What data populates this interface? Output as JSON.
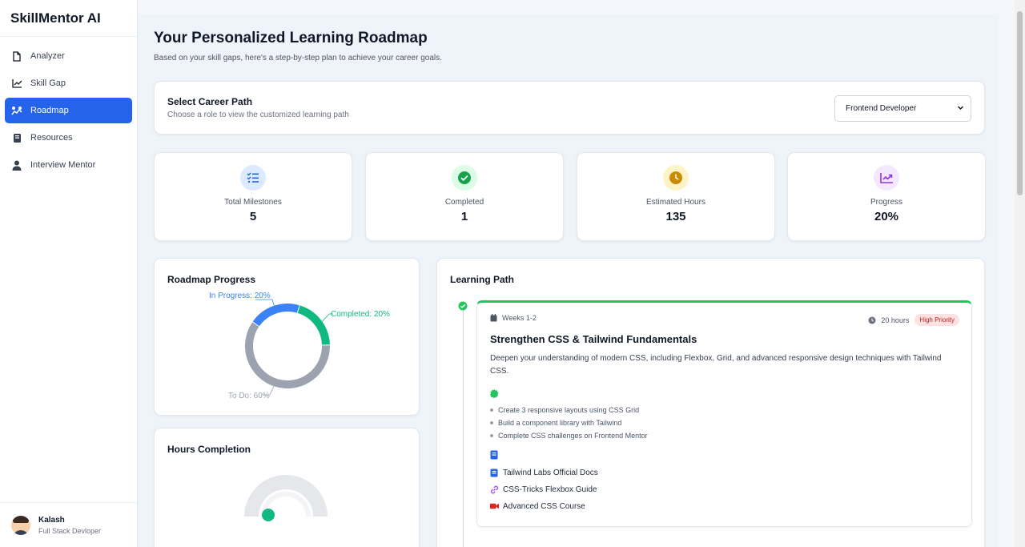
{
  "brand": "SkillMentor AI",
  "nav": [
    {
      "label": "Analyzer",
      "icon": "document-icon"
    },
    {
      "label": "Skill Gap",
      "icon": "chart-line-icon"
    },
    {
      "label": "Roadmap",
      "icon": "roadmap-icon",
      "active": true
    },
    {
      "label": "Resources",
      "icon": "book-icon"
    },
    {
      "label": "Interview Mentor",
      "icon": "user-icon"
    }
  ],
  "user": {
    "name": "Kalash",
    "role": "Full Stack Devloper"
  },
  "header": {
    "title": "Your Personalized Learning Roadmap",
    "subtitle": "Based on your skill gaps, here's a step-by-step plan to achieve your career goals."
  },
  "career": {
    "title": "Select Career Path",
    "subtitle": "Choose a role to view the customized learning path",
    "selected": "Frontend Developer"
  },
  "stats": [
    {
      "label": "Total Milestones",
      "value": "5",
      "icon": "list-check-icon",
      "color": "#3b82f6",
      "bg": "#dbeafe"
    },
    {
      "label": "Completed",
      "value": "1",
      "icon": "check-circle-icon",
      "color": "#16a34a",
      "bg": "#dcfce7"
    },
    {
      "label": "Estimated Hours",
      "value": "135",
      "icon": "clock-icon",
      "color": "#ca8a04",
      "bg": "#fef3c7"
    },
    {
      "label": "Progress",
      "value": "20%",
      "icon": "trend-icon",
      "color": "#9333ea",
      "bg": "#f3e8ff"
    }
  ],
  "roadmap_progress": {
    "title": "Roadmap Progress",
    "labels": {
      "in_progress": "In Progress: 20%",
      "completed": "Completed: 20%",
      "todo": "To Do: 60%"
    }
  },
  "chart_data": {
    "type": "pie",
    "title": "Roadmap Progress",
    "slices": [
      {
        "label": "Completed",
        "value": 20,
        "color": "#10b981"
      },
      {
        "label": "To Do",
        "value": 60,
        "color": "#9ca3af"
      },
      {
        "label": "In Progress",
        "value": 20,
        "color": "#3b82f6"
      }
    ]
  },
  "hours_completion": {
    "title": "Hours Completion",
    "fraction": 0.05,
    "color": "#10b981",
    "track": "#e5e7eb"
  },
  "learning_path": {
    "title": "Learning Path",
    "milestone": {
      "weeks": "Weeks 1-2",
      "hours": "20 hours",
      "priority": "High Priority",
      "title": "Strengthen CSS & Tailwind Fundamentals",
      "description": "Deepen your understanding of modern CSS, including Flexbox, Grid, and advanced responsive design techniques with Tailwind CSS.",
      "tasks": [
        "Create 3 responsive layouts using CSS Grid",
        "Build a component library with Tailwind",
        "Complete CSS challenges on Frontend Mentor"
      ],
      "resources": [
        {
          "label": "Tailwind Labs Official Docs",
          "icon": "book-icon",
          "color": "#2563eb"
        },
        {
          "label": "CSS-Tricks Flexbox Guide",
          "icon": "link-icon",
          "color": "#a855f7"
        },
        {
          "label": "Advanced CSS Course",
          "icon": "video-icon",
          "color": "#dc2626"
        }
      ]
    }
  }
}
